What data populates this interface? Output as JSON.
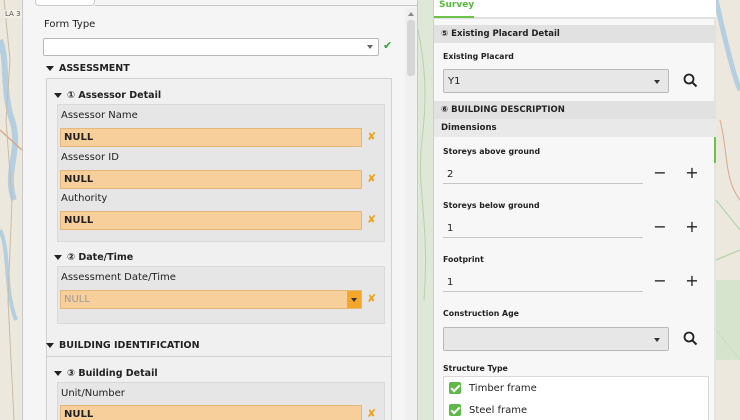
{
  "map": {
    "road_label": "LA 3"
  },
  "left_form": {
    "form_type": {
      "label": "Form Type",
      "value": ""
    },
    "assessment": {
      "title": "ASSESSMENT",
      "assessor_detail": {
        "title": "① Assessor Detail",
        "fields": [
          {
            "label": "Assessor Name",
            "value": "NULL"
          },
          {
            "label": "Assessor ID",
            "value": "NULL"
          },
          {
            "label": "Authority",
            "value": "NULL"
          }
        ]
      },
      "date_time": {
        "title": "② Date/Time",
        "field_label": "Assessment Date/Time",
        "field_value": "NULL"
      }
    },
    "building_identification": {
      "title": "BUILDING IDENTIFICATION",
      "building_detail": {
        "title": "③ Building Detail",
        "field_label": "Unit/Number",
        "field_value": "NULL"
      }
    }
  },
  "right_form": {
    "tab_label": "Survey",
    "existing_placard_detail": {
      "title": "⑤ Existing Placard Detail",
      "label": "Existing Placard",
      "value": "Y1"
    },
    "building_description": {
      "title": "⑥ BUILDING DESCRIPTION",
      "subtitle": "Dimensions",
      "storeys_above": {
        "label": "Storeys above ground",
        "value": "2"
      },
      "storeys_below": {
        "label": "Storeys below ground",
        "value": "1"
      },
      "footprint": {
        "label": "Footprint",
        "value": "1"
      },
      "construction_age": {
        "label": "Construction Age",
        "value": ""
      },
      "structure_type": {
        "label": "Structure Type",
        "options": [
          {
            "label": "Timber frame",
            "checked": true
          },
          {
            "label": "Steel frame",
            "checked": true
          }
        ]
      }
    },
    "stepper_minus": "−",
    "stepper_plus": "+"
  },
  "colors": {
    "null_fill": "#f6cf9b",
    "accent_green": "#6cc24a",
    "clear_orange": "#e8a422"
  }
}
